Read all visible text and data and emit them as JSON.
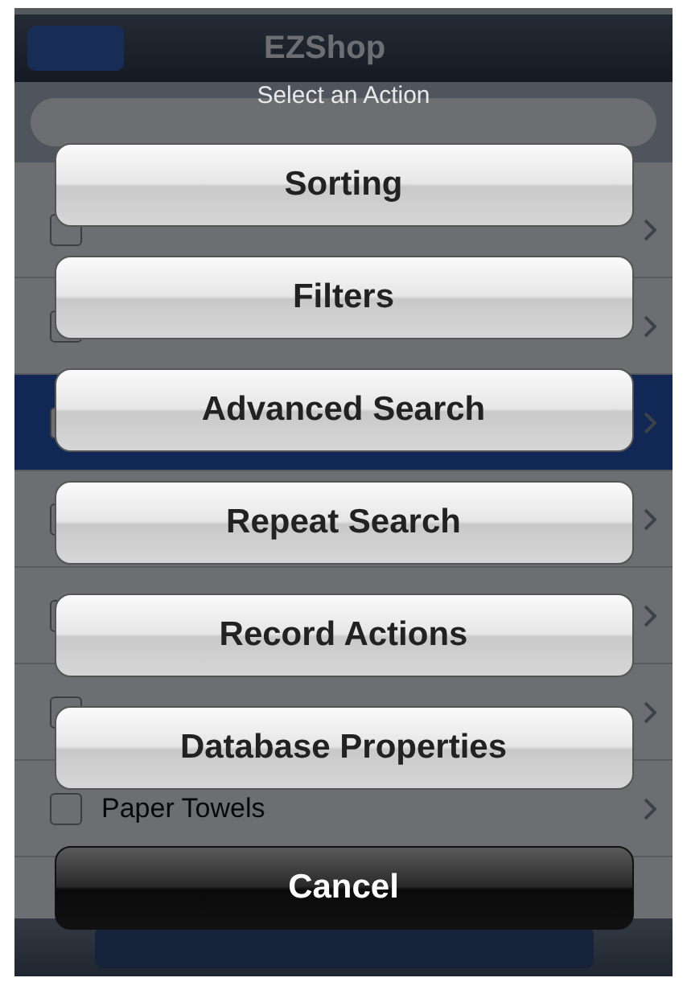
{
  "navigation_bar": {
    "title": "EZShop"
  },
  "list": {
    "rows": [
      {
        "selected": false
      },
      {
        "selected": false
      },
      {
        "selected": true
      },
      {
        "selected": false
      },
      {
        "selected": false
      },
      {
        "selected": false
      },
      {
        "label": "Paper Towels",
        "selected": false
      }
    ]
  },
  "action_sheet": {
    "title": "Select an Action",
    "actions": [
      {
        "label": "Sorting",
        "kind": "default"
      },
      {
        "label": "Filters",
        "kind": "default"
      },
      {
        "label": "Advanced Search",
        "kind": "default"
      },
      {
        "label": "Repeat Search",
        "kind": "default"
      },
      {
        "label": "Record Actions",
        "kind": "default"
      },
      {
        "label": "Database Properties",
        "kind": "default"
      },
      {
        "label": "Cancel",
        "kind": "cancel"
      }
    ]
  }
}
